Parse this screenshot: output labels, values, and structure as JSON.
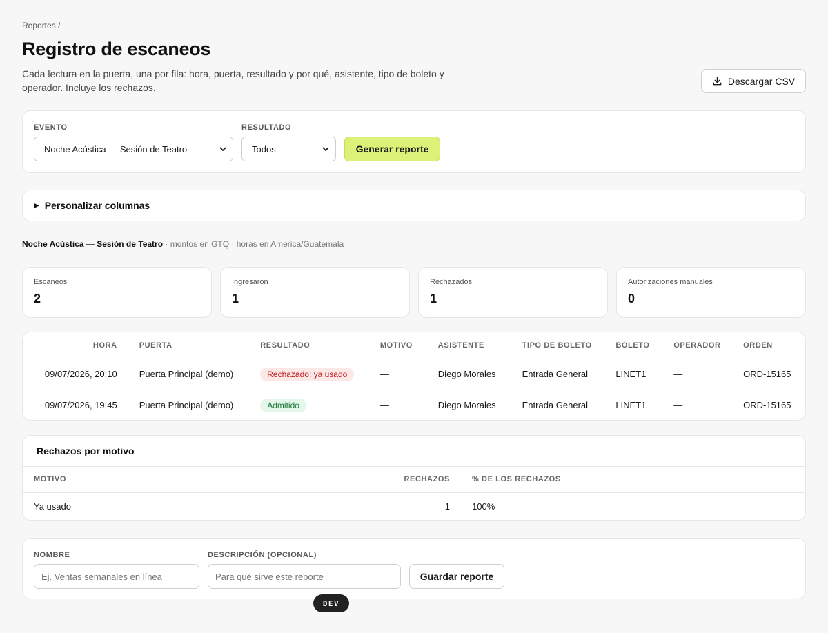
{
  "breadcrumb": "Reportes /",
  "title": "Registro de escaneos",
  "subtitle": "Cada lectura en la puerta, una por fila: hora, puerta, resultado y por qué, asistente, tipo de boleto y operador. Incluye los rechazos.",
  "csv_button": "Descargar CSV",
  "filters": {
    "event_label": "EVENTO",
    "event_value": "Noche Acústica — Sesión de Teatro",
    "result_label": "RESULTADO",
    "result_value": "Todos",
    "generate_button": "Generar reporte"
  },
  "customize_columns": "Personalizar columnas",
  "context": {
    "event": "Noche Acústica — Sesión de Teatro",
    "meta": " · montos en GTQ · horas en America/Guatemala"
  },
  "stats": [
    {
      "label": "Escaneos",
      "value": "2"
    },
    {
      "label": "Ingresaron",
      "value": "1"
    },
    {
      "label": "Rechazados",
      "value": "1"
    },
    {
      "label": "Autorizaciones manuales",
      "value": "0"
    }
  ],
  "scans_table": {
    "headers": [
      "HORA",
      "PUERTA",
      "RESULTADO",
      "MOTIVO",
      "ASISTENTE",
      "TIPO DE BOLETO",
      "BOLETO",
      "OPERADOR",
      "ORDEN"
    ],
    "rows": [
      {
        "time": "09/07/2026, 20:10",
        "gate": "Puerta Principal (demo)",
        "result": "Rechazado: ya usado",
        "reason": "—",
        "attendee": "Diego Morales",
        "ticket_type": "Entrada General",
        "ticket": "LINET1",
        "operator": "—",
        "order": "ORD-15165"
      },
      {
        "time": "09/07/2026, 19:45",
        "gate": "Puerta Principal (demo)",
        "result": "Admitido",
        "reason": "—",
        "attendee": "Diego Morales",
        "ticket_type": "Entrada General",
        "ticket": "LINET1",
        "operator": "—",
        "order": "ORD-15165"
      }
    ]
  },
  "reasons_section": {
    "title": "Rechazos por motivo",
    "headers": [
      "MOTIVO",
      "RECHAZOS",
      "% DE LOS RECHAZOS"
    ],
    "rows": [
      {
        "reason": "Ya usado",
        "count": "1",
        "pct": "100%"
      }
    ]
  },
  "save_form": {
    "name_label": "NOMBRE",
    "name_placeholder": "Ej. Ventas semanales en línea",
    "desc_label": "DESCRIPCIÓN (OPCIONAL)",
    "desc_placeholder": "Para qué sirve este reporte",
    "save_button": "Guardar reporte"
  },
  "dev_badge": "DEV",
  "colors": {
    "accent": "#dbf178",
    "reject_bg": "#fde8e8",
    "reject_text": "#c01b1b",
    "ok_bg": "#e5f6ea",
    "ok_text": "#1d7a3c"
  },
  "icons": {
    "csv": "download-icon",
    "select": "chevron-down-icon",
    "details": "triangle-right-icon"
  }
}
